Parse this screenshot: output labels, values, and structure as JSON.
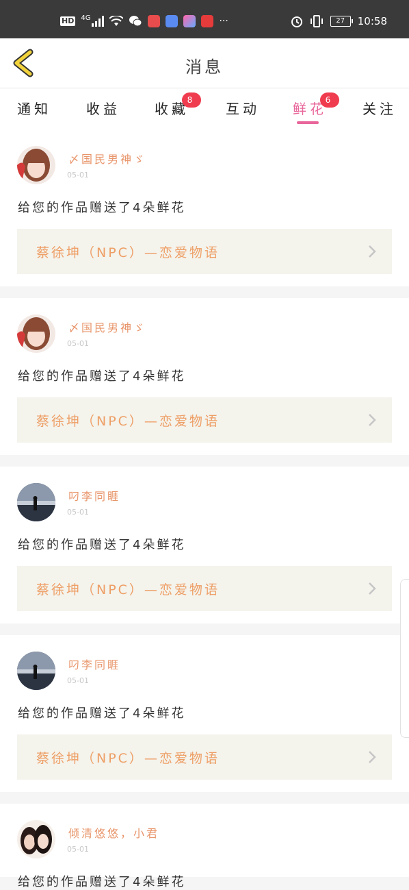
{
  "statusbar": {
    "network": "HD",
    "signal_type": "4G",
    "battery": "27",
    "time": "10:58"
  },
  "header": {
    "title": "消息"
  },
  "tabs": [
    {
      "label": "通知",
      "badge": ""
    },
    {
      "label": "收益",
      "badge": ""
    },
    {
      "label": "收藏",
      "badge": "8"
    },
    {
      "label": "互动",
      "badge": ""
    },
    {
      "label": "鲜花",
      "badge": "6"
    },
    {
      "label": "关注",
      "badge": ""
    }
  ],
  "messages": [
    {
      "username": "〆国民男神ゞ",
      "date": "05-01",
      "text": "给您的作品赠送了4朵鲜花",
      "work_title": "蔡徐坤（NPC）—恋爱物语",
      "avatar": "girl-avatar"
    },
    {
      "username": "〆国民男神ゞ",
      "date": "05-01",
      "text": "给您的作品赠送了4朵鲜花",
      "work_title": "蔡徐坤（NPC）—恋爱物语",
      "avatar": "girl-avatar"
    },
    {
      "username": "叼李同睚",
      "date": "05-01",
      "text": "给您的作品赠送了4朵鲜花",
      "work_title": "蔡徐坤（NPC）—恋爱物语",
      "avatar": "silhouette-avatar"
    },
    {
      "username": "叼李同睚",
      "date": "05-01",
      "text": "给您的作品赠送了4朵鲜花",
      "work_title": "蔡徐坤（NPC）—恋爱物语",
      "avatar": "silhouette-avatar"
    },
    {
      "username": "倾清悠悠，小君",
      "date": "05-01",
      "text": "给您的作品赠送了4朵鲜花",
      "work_title": "",
      "avatar": "two-girls-avatar"
    }
  ],
  "colors": {
    "accent": "#e8669b",
    "badge": "#f03c4f",
    "username": "#e8956a",
    "work_title": "#ee9f66",
    "back_arrow": "#f2d33c"
  }
}
